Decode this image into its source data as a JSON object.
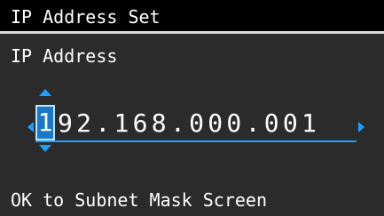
{
  "screen": {
    "title": "IP Address Set",
    "field_label": "IP Address",
    "ip_cursor_digit": "1",
    "ip_rest": "92.168.000.001",
    "hint": "OK to Subnet Mask Screen"
  },
  "colors": {
    "background": "#2b2b2b",
    "title_bar": "#000000",
    "accent": "#1aa0ff",
    "cursor_fill": "#1a78c8"
  },
  "icons": {
    "up": "triangle-up",
    "down": "triangle-down",
    "left": "triangle-left",
    "right": "triangle-right"
  }
}
